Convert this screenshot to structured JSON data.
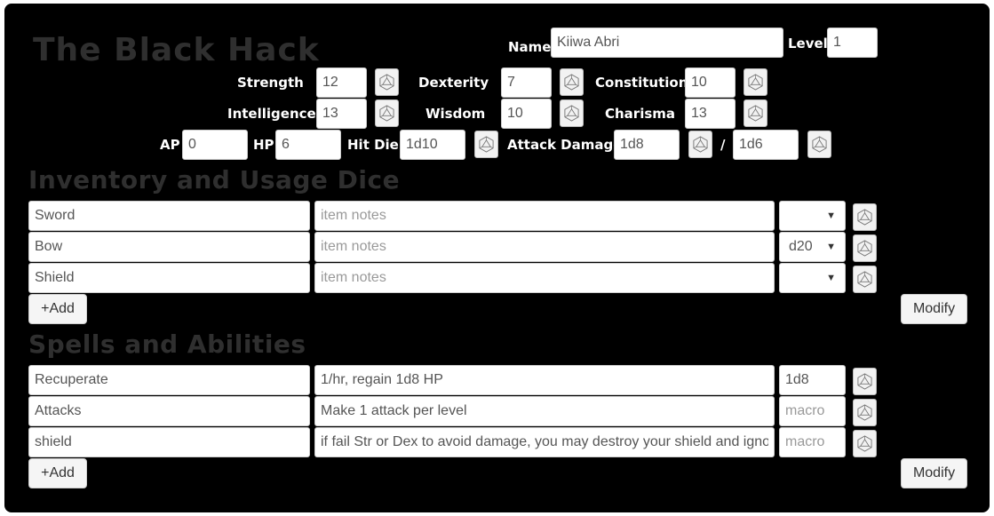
{
  "app": {
    "title": "The Black Hack"
  },
  "character": {
    "name_label": "Name",
    "name_value": "Kiiwa Abri",
    "level_label": "Level",
    "level_value": "1"
  },
  "stats": {
    "strength": {
      "label": "Strength",
      "value": "12"
    },
    "dexterity": {
      "label": "Dexterity",
      "value": "7"
    },
    "constitution": {
      "label": "Constitution",
      "value": "10"
    },
    "intelligence": {
      "label": "Intelligence",
      "value": "13"
    },
    "wisdom": {
      "label": "Wisdom",
      "value": "10"
    },
    "charisma": {
      "label": "Charisma",
      "value": "13"
    }
  },
  "combat": {
    "ap_label": "AP",
    "ap_value": "0",
    "hp_label": "HP",
    "hp_value": "6",
    "hitdie_label": "Hit Die",
    "hitdie_value": "1d10",
    "attack_label": "Attack Damage",
    "attack_value": "1d8",
    "separator": "/",
    "attack_value2": "1d6"
  },
  "inventory": {
    "heading": "Inventory and Usage Dice",
    "notes_placeholder": "item notes",
    "items": [
      {
        "name": "Sword",
        "notes": "",
        "dice": ""
      },
      {
        "name": "Bow",
        "notes": "",
        "dice": "d20"
      },
      {
        "name": "Shield",
        "notes": "",
        "dice": ""
      }
    ],
    "add_label": "+Add",
    "modify_label": "Modify"
  },
  "spells": {
    "heading": "Spells and Abilities",
    "macro_placeholder": "macro",
    "items": [
      {
        "name": "Recuperate",
        "desc": "1/hr, regain 1d8 HP",
        "macro": "1d8"
      },
      {
        "name": "Attacks",
        "desc": "Make 1 attack per level",
        "macro": ""
      },
      {
        "name": "shield",
        "desc": "if fail Str or Dex to avoid damage, you may destroy your shield and igno",
        "macro": ""
      }
    ],
    "add_label": "+Add",
    "modify_label": "Modify"
  },
  "icons": {
    "roll": "d20-dice-icon",
    "dropdown": "chevron-down-icon"
  }
}
